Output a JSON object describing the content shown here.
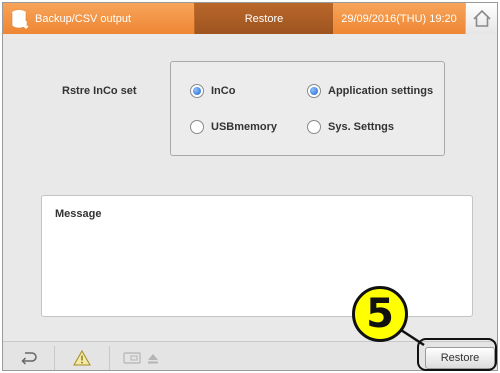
{
  "header": {
    "app_title": "Backup/CSV output",
    "screen_title": "Restore",
    "datetime": "29/09/2016(THU) 19:20",
    "home_icon": "home-icon",
    "app_icon": "database-icon",
    "colors": {
      "accent": "#f19444",
      "active_tab": "#a85a23"
    }
  },
  "settings": {
    "label": "Rstre InCo set",
    "options": [
      {
        "label": "InCo",
        "selected": true
      },
      {
        "label": "Application settings",
        "selected": true
      },
      {
        "label": "USBmemory",
        "selected": false
      },
      {
        "label": "Sys. Settngs",
        "selected": false
      }
    ]
  },
  "message": {
    "label": "Message",
    "text": ""
  },
  "footer": {
    "back_icon": "back-icon",
    "warning_icon": "warning-icon",
    "media_icon": "media-eject-icon",
    "restore_label": "Restore"
  },
  "annotation": {
    "step_number": "5",
    "colors": {
      "badge": "#ffff00"
    }
  }
}
